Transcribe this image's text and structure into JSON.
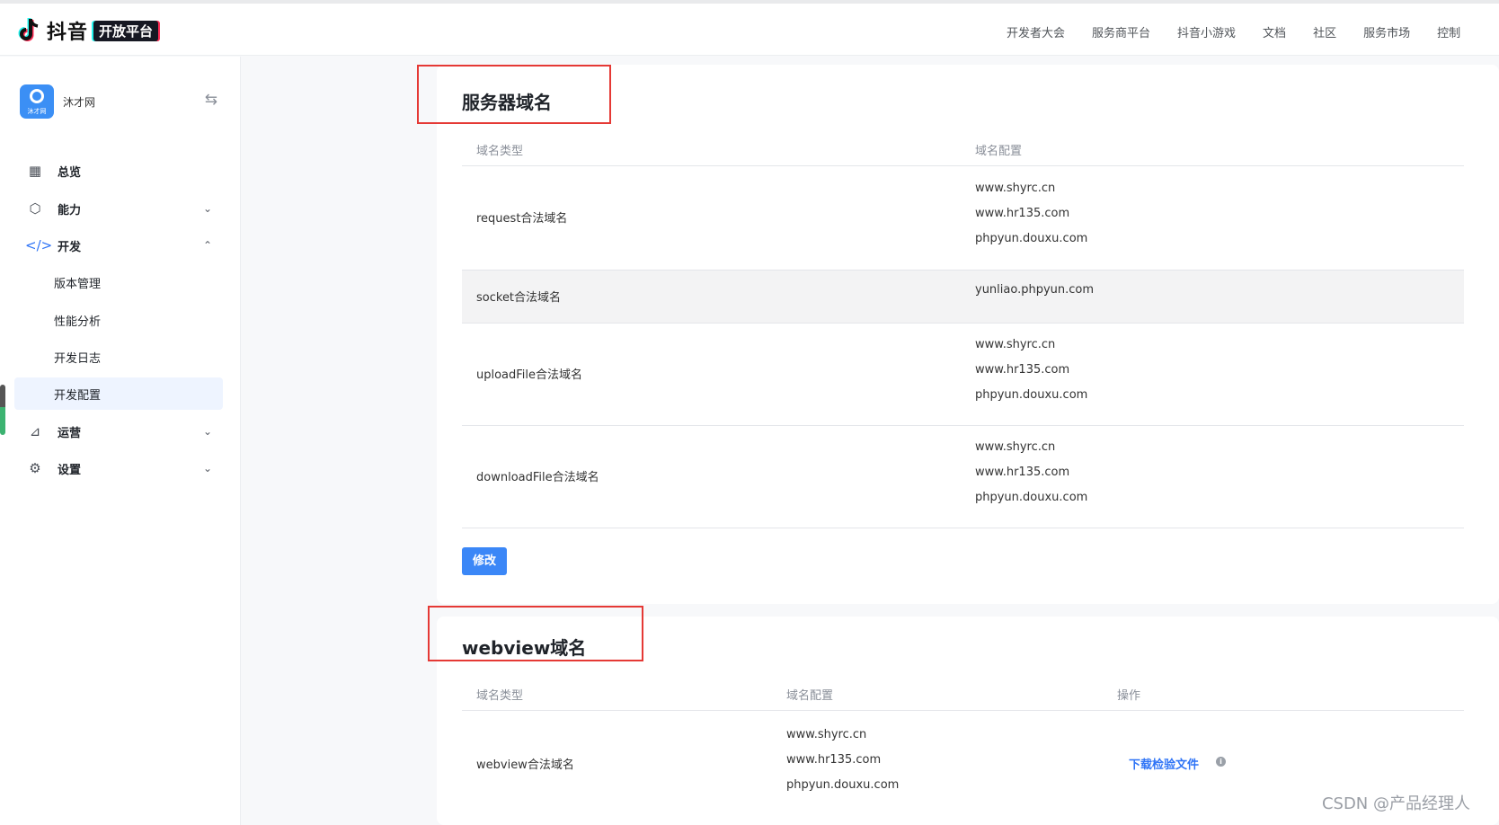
{
  "brand": {
    "name": "抖音",
    "badge": "开放平台"
  },
  "topnav": [
    "开发者大会",
    "服务商平台",
    "抖音小游戏",
    "文档",
    "社区",
    "服务市场",
    "控制"
  ],
  "app": {
    "avatar_label": "沐才网",
    "name": "沐才网"
  },
  "sidebar": {
    "items": [
      {
        "label": "总览",
        "icon": "dashboard-icon"
      },
      {
        "label": "能力",
        "icon": "capability-icon"
      },
      {
        "label": "开发",
        "icon": "code-icon"
      },
      {
        "label": "运营",
        "icon": "chart-icon"
      },
      {
        "label": "设置",
        "icon": "gear-icon"
      }
    ],
    "dev_sub": [
      "版本管理",
      "性能分析",
      "开发日志",
      "开发配置"
    ],
    "active": "开发配置"
  },
  "server_domains": {
    "title": "服务器域名",
    "headers": {
      "type": "域名类型",
      "config": "域名配置"
    },
    "rows": [
      {
        "type": "request合法域名",
        "domains": [
          "www.shyrc.cn",
          "www.hr135.com",
          "phpyun.douxu.com"
        ]
      },
      {
        "type": "socket合法域名",
        "domains": [
          "yunliao.phpyun.com"
        ]
      },
      {
        "type": "uploadFile合法域名",
        "domains": [
          "www.shyrc.cn",
          "www.hr135.com",
          "phpyun.douxu.com"
        ]
      },
      {
        "type": "downloadFile合法域名",
        "domains": [
          "www.shyrc.cn",
          "www.hr135.com",
          "phpyun.douxu.com"
        ]
      }
    ],
    "edit_label": "修改"
  },
  "webview_domains": {
    "title": "webview域名",
    "headers": {
      "type": "域名类型",
      "config": "域名配置",
      "action": "操作"
    },
    "row": {
      "type": "webview合法域名",
      "domains": [
        "www.shyrc.cn",
        "www.hr135.com",
        "phpyun.douxu.com"
      ],
      "action": "下载检验文件"
    }
  },
  "watermark": "CSDN @产品经理人"
}
